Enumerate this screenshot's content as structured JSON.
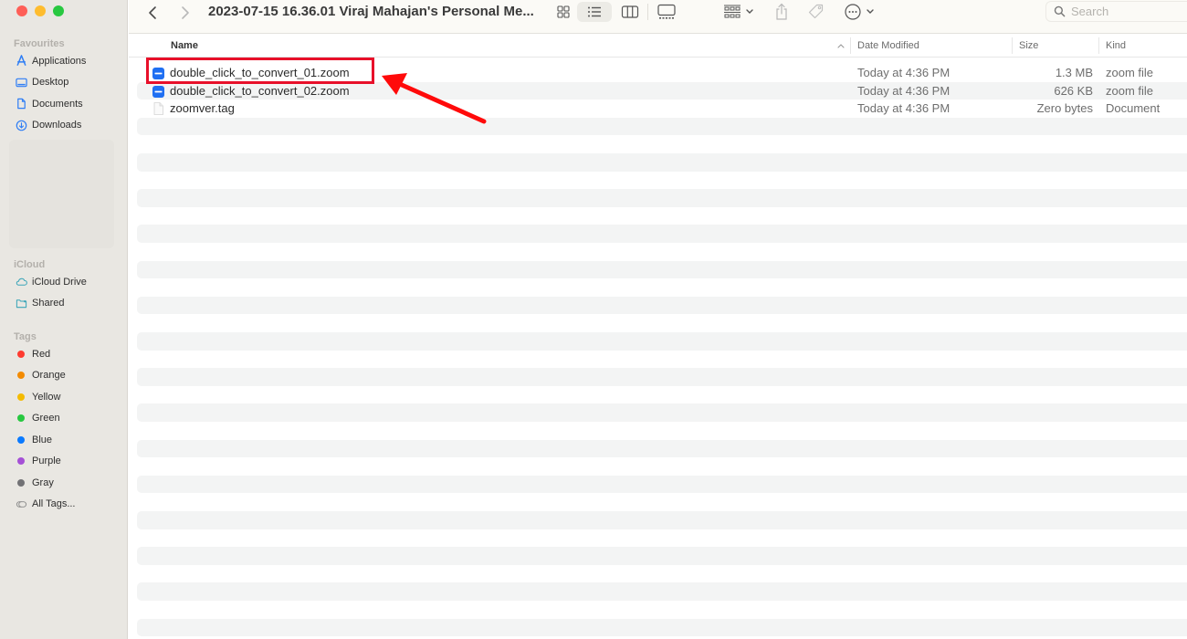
{
  "window": {
    "title": "2023-07-15 16.36.01 Viraj Mahajan's Personal Me...",
    "traffic_lights": [
      "close",
      "minimize",
      "maximize"
    ]
  },
  "toolbar": {
    "back_icon": "chevron-left-icon",
    "forward_icon": "chevron-right-icon",
    "view_modes": [
      "icon-view",
      "list-view",
      "column-view",
      "gallery-view"
    ],
    "active_view": "list-view",
    "group_icon": "group-by-icon",
    "share_icon": "share-icon",
    "tag_icon": "tag-icon",
    "more_icon": "more-actions-icon",
    "search_placeholder": "Search",
    "search_value": ""
  },
  "sidebar": {
    "favourites": {
      "heading": "Favourites",
      "items": [
        {
          "label": "Applications",
          "icon": "applications-icon"
        },
        {
          "label": "Desktop",
          "icon": "desktop-icon"
        },
        {
          "label": "Documents",
          "icon": "document-icon"
        },
        {
          "label": "Downloads",
          "icon": "downloads-icon"
        }
      ]
    },
    "icloud": {
      "heading": "iCloud",
      "items": [
        {
          "label": "iCloud Drive",
          "icon": "cloud-icon"
        },
        {
          "label": "Shared",
          "icon": "shared-folder-icon"
        }
      ]
    },
    "tags": {
      "heading": "Tags",
      "items": [
        {
          "label": "Red",
          "color": "#fe3b30"
        },
        {
          "label": "Orange",
          "color": "#f38b00"
        },
        {
          "label": "Yellow",
          "color": "#f4bb00"
        },
        {
          "label": "Green",
          "color": "#27c840"
        },
        {
          "label": "Blue",
          "color": "#0a7aff"
        },
        {
          "label": "Purple",
          "color": "#a550d6"
        },
        {
          "label": "Gray",
          "color": "#727275"
        }
      ],
      "all_tags": "All Tags..."
    }
  },
  "columns": {
    "name": "Name",
    "date": "Date Modified",
    "size": "Size",
    "kind": "Kind",
    "sort_indicator": "^"
  },
  "files": [
    {
      "name": "double_click_to_convert_01.zoom",
      "date": "Today at 4:36 PM",
      "size": "1.3 MB",
      "kind": "zoom file",
      "icon": "zoom-file-icon"
    },
    {
      "name": "double_click_to_convert_02.zoom",
      "date": "Today at 4:36 PM",
      "size": "626 KB",
      "kind": "zoom file",
      "icon": "zoom-file-icon"
    },
    {
      "name": "zoomver.tag",
      "date": "Today at 4:36 PM",
      "size": "Zero bytes",
      "kind": "Document",
      "icon": "generic-file-icon"
    }
  ],
  "annotation": {
    "highlighted_file": "double_click_to_convert_01.zoom",
    "color": "#e8102a"
  },
  "colors": {
    "accent": "#0a7aff",
    "sidebar_bg": "#e9e7e2",
    "toolbar_bg": "#fbfaf6",
    "stripe": "#f3f4f4"
  }
}
